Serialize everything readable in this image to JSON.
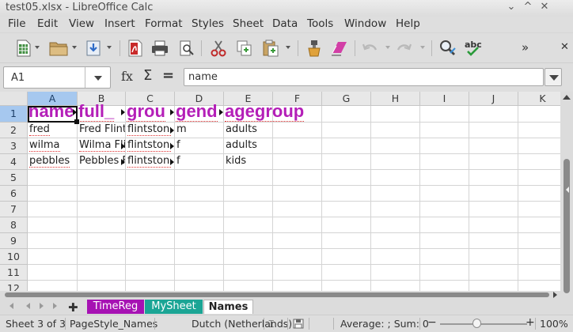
{
  "window": {
    "title": "test05.xlsx - LibreOffice Calc",
    "controls": [
      "⌄",
      "^",
      "✕"
    ]
  },
  "menu": [
    "File",
    "Edit",
    "View",
    "Insert",
    "Format",
    "Styles",
    "Sheet",
    "Data",
    "Tools",
    "Window",
    "Help"
  ],
  "toolbar": {
    "icons": [
      "new-icon",
      "open-icon",
      "save-icon",
      "export-pdf-icon",
      "print-icon",
      "print-preview-icon",
      "cut-icon",
      "copy-icon",
      "paste-icon",
      "clone-formatting-icon",
      "clear-formatting-icon",
      "undo-icon",
      "redo-icon",
      "find-replace-icon",
      "spelling-icon"
    ],
    "overflow": "»",
    "close": "✕"
  },
  "formula_bar": {
    "name_box": "A1",
    "fx": "fx",
    "sigma": "Σ",
    "equals": "=",
    "content": "name"
  },
  "grid": {
    "columns": [
      "A",
      "B",
      "C",
      "D",
      "E",
      "F",
      "G",
      "H",
      "I",
      "J",
      "K"
    ],
    "rows": [
      "1",
      "2",
      "3",
      "4",
      "5",
      "6",
      "7",
      "8",
      "9",
      "10",
      "11",
      "12"
    ],
    "header_row": [
      "name",
      "full_",
      "grou",
      "gend",
      "agegroup"
    ],
    "data": [
      [
        "fred",
        "Fred Flint",
        "flintstone",
        "m",
        "adults"
      ],
      [
        "wilma",
        "Wilma Flin",
        "flintstone",
        "f",
        "adults"
      ],
      [
        "pebbles",
        "Pebbles F",
        "flintstone",
        "f",
        "kids"
      ]
    ],
    "header_color": "#b41fb8",
    "selection_color": "#a6c8ef"
  },
  "sheets": [
    {
      "name": "TimeReg",
      "color": "#a612b3"
    },
    {
      "name": "MySheet",
      "color": "#1ba595"
    },
    {
      "name": "Names",
      "color": "#ffffff",
      "active": true
    }
  ],
  "status": {
    "sheet": "Sheet 3 of 3",
    "page_style": "PageStyle_Names",
    "language": "Dutch (Netherlands)",
    "insert_mode": "⌶",
    "stats": "Average: ; Sum: 0",
    "zoom_minus": "−",
    "zoom_plus": "+",
    "zoom": "100%",
    "zoom_level": 1.0
  }
}
